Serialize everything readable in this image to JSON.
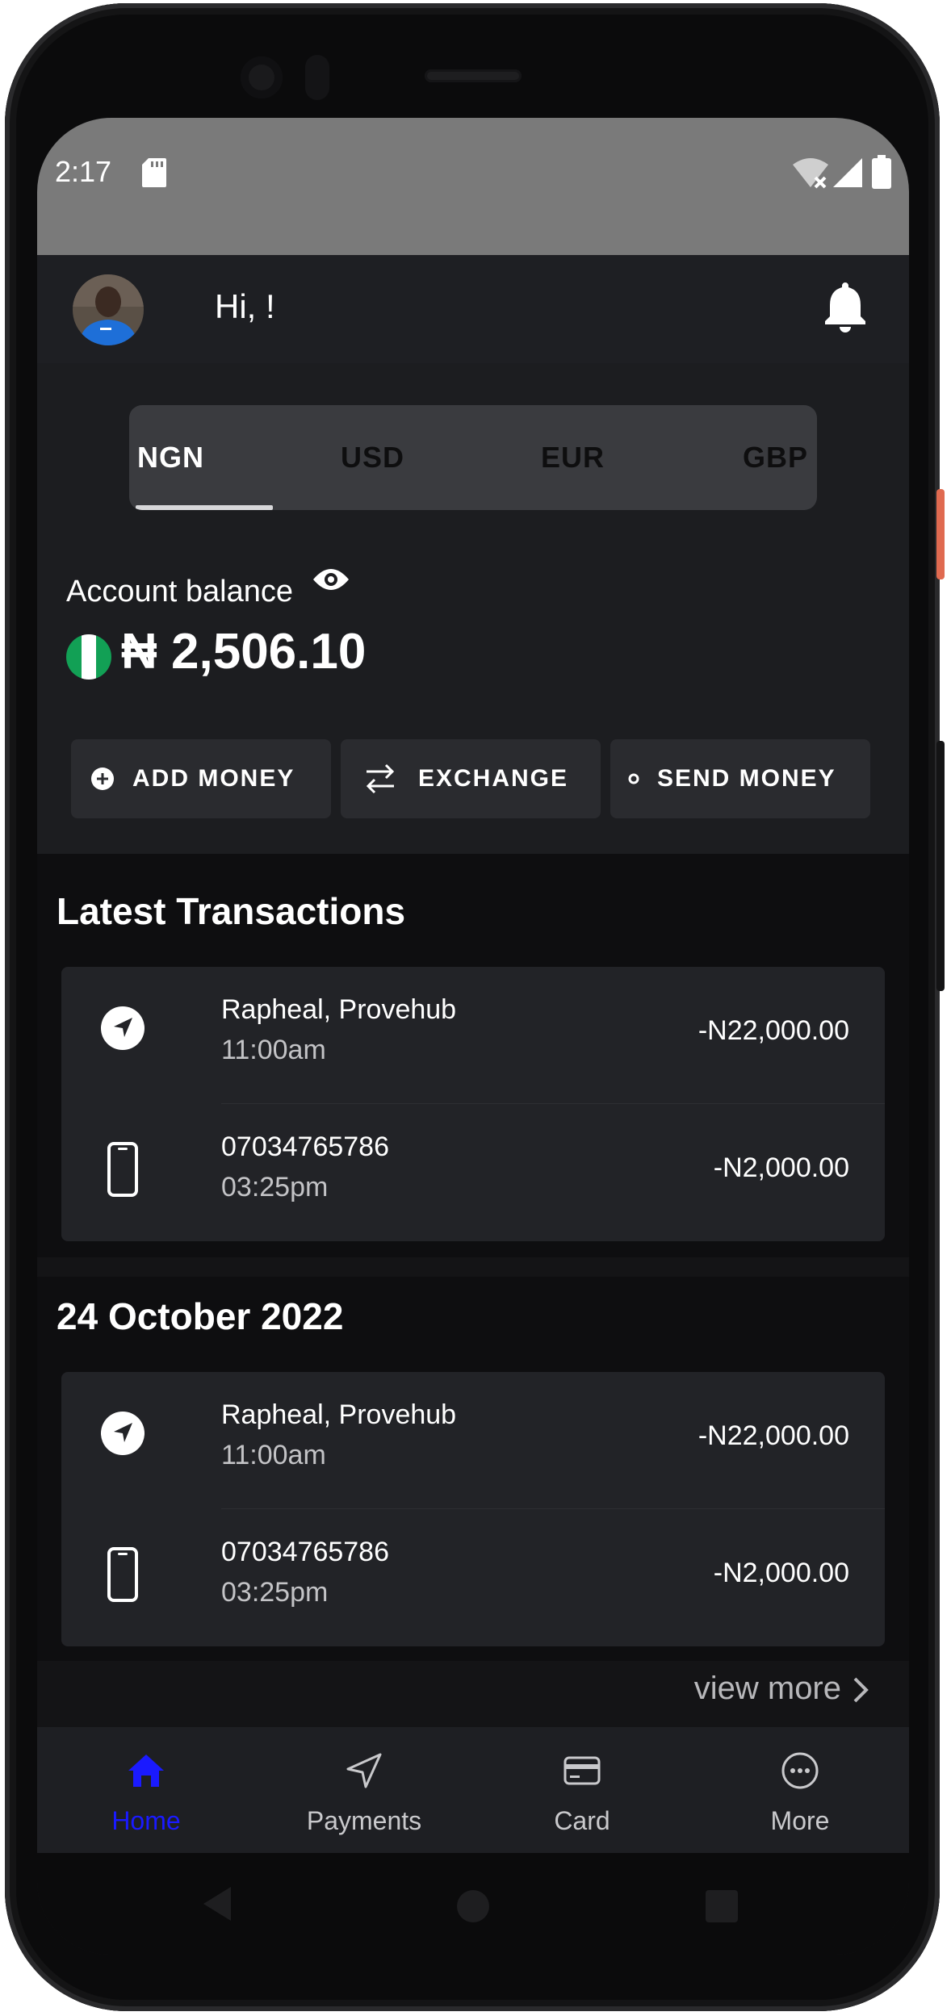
{
  "status_bar": {
    "time": "2:17"
  },
  "header": {
    "greeting": "Hi, !"
  },
  "currency_tabs": [
    {
      "label": "NGN",
      "active": true
    },
    {
      "label": "USD",
      "active": false
    },
    {
      "label": "EUR",
      "active": false
    },
    {
      "label": "GBP",
      "active": false
    }
  ],
  "balance": {
    "label": "Account balance",
    "amount": "₦ 2,506.10"
  },
  "actions": {
    "add_money": "ADD MONEY",
    "exchange": "EXCHANGE",
    "send_money": "SEND MONEY"
  },
  "sections": [
    {
      "title": "Latest Transactions",
      "transactions": [
        {
          "icon": "navigation-arrow-icon",
          "name": "Rapheal, Provehub",
          "time": "11:00am",
          "amount": "-N22,000.00"
        },
        {
          "icon": "phone-icon",
          "name": "07034765786",
          "time": "03:25pm",
          "amount": "-N2,000.00"
        }
      ]
    },
    {
      "title": "24 October 2022",
      "transactions": [
        {
          "icon": "navigation-arrow-icon",
          "name": "Rapheal, Provehub",
          "time": "11:00am",
          "amount": "-N22,000.00"
        },
        {
          "icon": "phone-icon",
          "name": "07034765786",
          "time": "03:25pm",
          "amount": "-N2,000.00"
        }
      ]
    }
  ],
  "view_more": "view more",
  "bottom_nav": [
    {
      "label": "Home",
      "active": true
    },
    {
      "label": "Payments",
      "active": false
    },
    {
      "label": "Card",
      "active": false
    },
    {
      "label": "More",
      "active": false
    }
  ],
  "colors": {
    "accent": "#1a1aff",
    "surface": "#1c1d20",
    "card": "#222327"
  }
}
